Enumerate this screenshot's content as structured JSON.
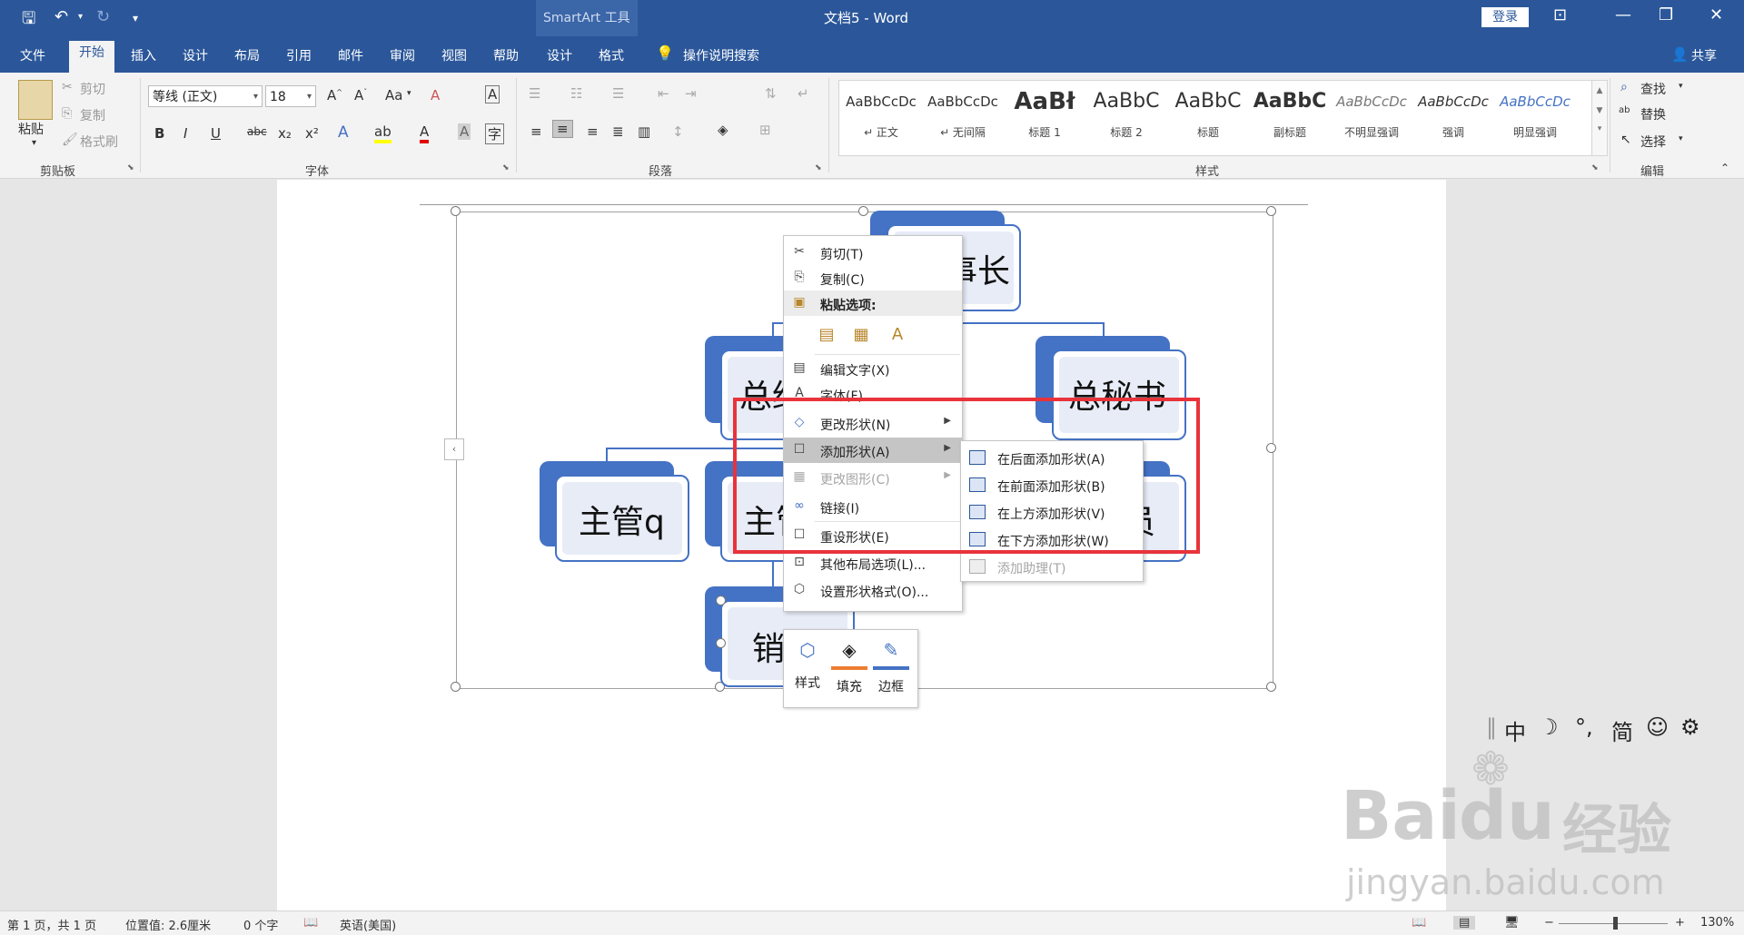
{
  "window": {
    "doc_title": "文档5 - Word",
    "context_label": "SmartArt 工具",
    "login_label": "登录",
    "share_label": "共享"
  },
  "tabs": [
    "文件",
    "开始",
    "插入",
    "设计",
    "布局",
    "引用",
    "邮件",
    "审阅",
    "视图",
    "帮助",
    "设计",
    "格式"
  ],
  "search_tab": "操作说明搜索",
  "ribbon": {
    "clipboard": {
      "paste": "粘贴",
      "cut": "剪切",
      "copy": "复制",
      "format_painter": "格式刷",
      "label": "剪贴板"
    },
    "font": {
      "name": "等线 (正文)",
      "size": "18",
      "label": "字体",
      "change_case": "Aa"
    },
    "paragraph": {
      "label": "段落"
    },
    "styles": {
      "label": "样式",
      "items": [
        {
          "sample": "AaBbCcDc",
          "name": "↵ 正文"
        },
        {
          "sample": "AaBbCcDc",
          "name": "↵ 无间隔"
        },
        {
          "sample": "AaBł",
          "name": "标题 1"
        },
        {
          "sample": "AaBbC",
          "name": "标题 2"
        },
        {
          "sample": "AaBbC",
          "name": "标题"
        },
        {
          "sample": "AaBbC",
          "name": "副标题"
        },
        {
          "sample": "AaBbCcDc",
          "name": "不明显强调"
        },
        {
          "sample": "AaBbCcDc",
          "name": "强调"
        },
        {
          "sample": "AaBbCcDc",
          "name": "明显强调"
        }
      ]
    },
    "editing": {
      "find": "查找",
      "replace": "替换",
      "select": "选择",
      "label": "编辑"
    }
  },
  "smartart": {
    "nodes": {
      "chairman": "董事长",
      "gm": "总经",
      "secretary": "总秘书",
      "mgr_q": "主管q",
      "mgr": "主管",
      "staff": "员",
      "sales": "销售"
    }
  },
  "context_menu": {
    "items": [
      {
        "label": "剪切(T)",
        "icon": "✂"
      },
      {
        "label": "复制(C)",
        "icon": "⎘"
      },
      {
        "label": "粘贴选项:",
        "icon": "📋"
      },
      {
        "label": "编辑文字(X)",
        "icon": "▤"
      },
      {
        "label": "字体(F)...",
        "icon": "A"
      },
      {
        "label": "更改形状(N)",
        "icon": "◇"
      },
      {
        "label": "添加形状(A)",
        "icon": "☐"
      },
      {
        "label": "更改图形(C)",
        "icon": "▦"
      },
      {
        "label": "链接(I)",
        "icon": "∞"
      },
      {
        "label": "重设形状(E)",
        "icon": "☐"
      },
      {
        "label": "其他布局选项(L)...",
        "icon": "⊡"
      },
      {
        "label": "设置形状格式(O)...",
        "icon": "⬡"
      }
    ]
  },
  "submenu": {
    "items": [
      {
        "label": "在后面添加形状(A)"
      },
      {
        "label": "在前面添加形状(B)"
      },
      {
        "label": "在上方添加形状(V)"
      },
      {
        "label": "在下方添加形状(W)"
      },
      {
        "label": "添加助理(T)"
      }
    ]
  },
  "mini_toolbar": {
    "style": "样式",
    "fill": "填充",
    "border": "边框"
  },
  "ime_bar": {
    "lang": "中",
    "punct": "°,",
    "script": "简"
  },
  "watermark": {
    "brand": "Bai",
    "brand2": "经验",
    "url": "jingyan.baidu.com"
  },
  "status": {
    "page": "第 1 页，共 1 页",
    "position": "位置值: 2.6厘米",
    "words": "0 个字",
    "language": "英语(美国)",
    "zoom": "130%"
  },
  "colors": {
    "brand": "#2b579a",
    "smartart": "#4472c4",
    "highlight_box": "#e8333b"
  }
}
